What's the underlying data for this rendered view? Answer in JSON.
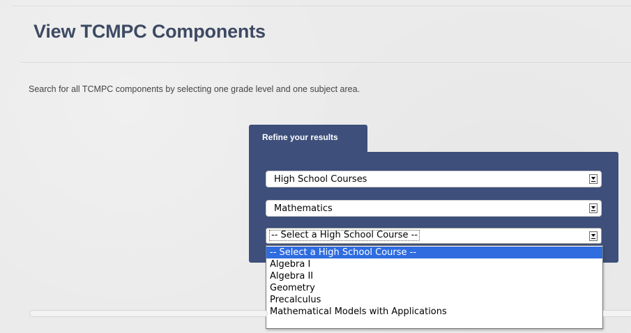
{
  "page": {
    "title": "View TCMPC Components",
    "intro": "Search for all TCMPC components by selecting one grade level and one subject area."
  },
  "refine": {
    "tab_label": "Refine your results",
    "grade_select": {
      "value": "High School Courses"
    },
    "subject_select": {
      "value": "Mathematics"
    },
    "course_select": {
      "value": "-- Select a High School Course --",
      "options": [
        "-- Select a High School Course --",
        "Algebra I",
        "Algebra II",
        "Geometry",
        "Precalculus",
        "Mathematical Models with Applications"
      ],
      "highlighted_index": 0
    }
  },
  "colors": {
    "panel": "#3d4f7a",
    "title": "#3e4a63",
    "highlight": "#2e6ce0"
  },
  "icons": {
    "select_arrow": "chevron-down-icon"
  }
}
